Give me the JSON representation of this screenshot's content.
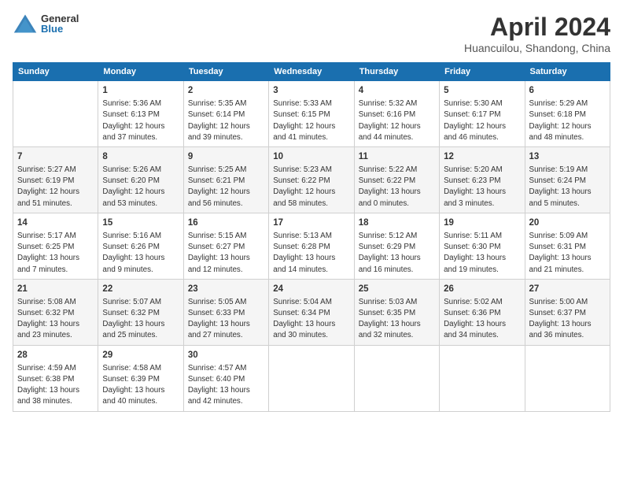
{
  "logo": {
    "general": "General",
    "blue": "Blue"
  },
  "title": "April 2024",
  "location": "Huancuilou, Shandong, China",
  "days_header": [
    "Sunday",
    "Monday",
    "Tuesday",
    "Wednesday",
    "Thursday",
    "Friday",
    "Saturday"
  ],
  "weeks": [
    [
      {
        "day": "",
        "sunrise": "",
        "sunset": "",
        "daylight": ""
      },
      {
        "day": "1",
        "sunrise": "Sunrise: 5:36 AM",
        "sunset": "Sunset: 6:13 PM",
        "daylight": "Daylight: 12 hours and 37 minutes."
      },
      {
        "day": "2",
        "sunrise": "Sunrise: 5:35 AM",
        "sunset": "Sunset: 6:14 PM",
        "daylight": "Daylight: 12 hours and 39 minutes."
      },
      {
        "day": "3",
        "sunrise": "Sunrise: 5:33 AM",
        "sunset": "Sunset: 6:15 PM",
        "daylight": "Daylight: 12 hours and 41 minutes."
      },
      {
        "day": "4",
        "sunrise": "Sunrise: 5:32 AM",
        "sunset": "Sunset: 6:16 PM",
        "daylight": "Daylight: 12 hours and 44 minutes."
      },
      {
        "day": "5",
        "sunrise": "Sunrise: 5:30 AM",
        "sunset": "Sunset: 6:17 PM",
        "daylight": "Daylight: 12 hours and 46 minutes."
      },
      {
        "day": "6",
        "sunrise": "Sunrise: 5:29 AM",
        "sunset": "Sunset: 6:18 PM",
        "daylight": "Daylight: 12 hours and 48 minutes."
      }
    ],
    [
      {
        "day": "7",
        "sunrise": "Sunrise: 5:27 AM",
        "sunset": "Sunset: 6:19 PM",
        "daylight": "Daylight: 12 hours and 51 minutes."
      },
      {
        "day": "8",
        "sunrise": "Sunrise: 5:26 AM",
        "sunset": "Sunset: 6:20 PM",
        "daylight": "Daylight: 12 hours and 53 minutes."
      },
      {
        "day": "9",
        "sunrise": "Sunrise: 5:25 AM",
        "sunset": "Sunset: 6:21 PM",
        "daylight": "Daylight: 12 hours and 56 minutes."
      },
      {
        "day": "10",
        "sunrise": "Sunrise: 5:23 AM",
        "sunset": "Sunset: 6:22 PM",
        "daylight": "Daylight: 12 hours and 58 minutes."
      },
      {
        "day": "11",
        "sunrise": "Sunrise: 5:22 AM",
        "sunset": "Sunset: 6:22 PM",
        "daylight": "Daylight: 13 hours and 0 minutes."
      },
      {
        "day": "12",
        "sunrise": "Sunrise: 5:20 AM",
        "sunset": "Sunset: 6:23 PM",
        "daylight": "Daylight: 13 hours and 3 minutes."
      },
      {
        "day": "13",
        "sunrise": "Sunrise: 5:19 AM",
        "sunset": "Sunset: 6:24 PM",
        "daylight": "Daylight: 13 hours and 5 minutes."
      }
    ],
    [
      {
        "day": "14",
        "sunrise": "Sunrise: 5:17 AM",
        "sunset": "Sunset: 6:25 PM",
        "daylight": "Daylight: 13 hours and 7 minutes."
      },
      {
        "day": "15",
        "sunrise": "Sunrise: 5:16 AM",
        "sunset": "Sunset: 6:26 PM",
        "daylight": "Daylight: 13 hours and 9 minutes."
      },
      {
        "day": "16",
        "sunrise": "Sunrise: 5:15 AM",
        "sunset": "Sunset: 6:27 PM",
        "daylight": "Daylight: 13 hours and 12 minutes."
      },
      {
        "day": "17",
        "sunrise": "Sunrise: 5:13 AM",
        "sunset": "Sunset: 6:28 PM",
        "daylight": "Daylight: 13 hours and 14 minutes."
      },
      {
        "day": "18",
        "sunrise": "Sunrise: 5:12 AM",
        "sunset": "Sunset: 6:29 PM",
        "daylight": "Daylight: 13 hours and 16 minutes."
      },
      {
        "day": "19",
        "sunrise": "Sunrise: 5:11 AM",
        "sunset": "Sunset: 6:30 PM",
        "daylight": "Daylight: 13 hours and 19 minutes."
      },
      {
        "day": "20",
        "sunrise": "Sunrise: 5:09 AM",
        "sunset": "Sunset: 6:31 PM",
        "daylight": "Daylight: 13 hours and 21 minutes."
      }
    ],
    [
      {
        "day": "21",
        "sunrise": "Sunrise: 5:08 AM",
        "sunset": "Sunset: 6:32 PM",
        "daylight": "Daylight: 13 hours and 23 minutes."
      },
      {
        "day": "22",
        "sunrise": "Sunrise: 5:07 AM",
        "sunset": "Sunset: 6:32 PM",
        "daylight": "Daylight: 13 hours and 25 minutes."
      },
      {
        "day": "23",
        "sunrise": "Sunrise: 5:05 AM",
        "sunset": "Sunset: 6:33 PM",
        "daylight": "Daylight: 13 hours and 27 minutes."
      },
      {
        "day": "24",
        "sunrise": "Sunrise: 5:04 AM",
        "sunset": "Sunset: 6:34 PM",
        "daylight": "Daylight: 13 hours and 30 minutes."
      },
      {
        "day": "25",
        "sunrise": "Sunrise: 5:03 AM",
        "sunset": "Sunset: 6:35 PM",
        "daylight": "Daylight: 13 hours and 32 minutes."
      },
      {
        "day": "26",
        "sunrise": "Sunrise: 5:02 AM",
        "sunset": "Sunset: 6:36 PM",
        "daylight": "Daylight: 13 hours and 34 minutes."
      },
      {
        "day": "27",
        "sunrise": "Sunrise: 5:00 AM",
        "sunset": "Sunset: 6:37 PM",
        "daylight": "Daylight: 13 hours and 36 minutes."
      }
    ],
    [
      {
        "day": "28",
        "sunrise": "Sunrise: 4:59 AM",
        "sunset": "Sunset: 6:38 PM",
        "daylight": "Daylight: 13 hours and 38 minutes."
      },
      {
        "day": "29",
        "sunrise": "Sunrise: 4:58 AM",
        "sunset": "Sunset: 6:39 PM",
        "daylight": "Daylight: 13 hours and 40 minutes."
      },
      {
        "day": "30",
        "sunrise": "Sunrise: 4:57 AM",
        "sunset": "Sunset: 6:40 PM",
        "daylight": "Daylight: 13 hours and 42 minutes."
      },
      {
        "day": "",
        "sunrise": "",
        "sunset": "",
        "daylight": ""
      },
      {
        "day": "",
        "sunrise": "",
        "sunset": "",
        "daylight": ""
      },
      {
        "day": "",
        "sunrise": "",
        "sunset": "",
        "daylight": ""
      },
      {
        "day": "",
        "sunrise": "",
        "sunset": "",
        "daylight": ""
      }
    ]
  ]
}
